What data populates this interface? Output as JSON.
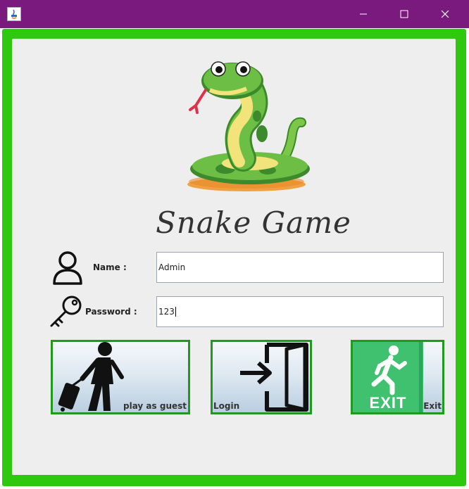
{
  "window": {
    "minimize_glyph": "—",
    "maximize_glyph": "☐",
    "close_glyph": "✕"
  },
  "header": {
    "title": "Snake Game"
  },
  "form": {
    "name_label": "Name :",
    "name_value": "Admin",
    "password_label": "Password :",
    "password_value": "123"
  },
  "buttons": {
    "guest_label": "play as guest",
    "login_label": "Login",
    "exit_label": "Exit",
    "exit_sign_text": "EXIT"
  },
  "colors": {
    "titlebar": "#7b1a7e",
    "frame": "#2ec90f",
    "panel": "#eeeeee",
    "button_border": "#1f9a1f",
    "exit_sign": "#3fc16f"
  }
}
